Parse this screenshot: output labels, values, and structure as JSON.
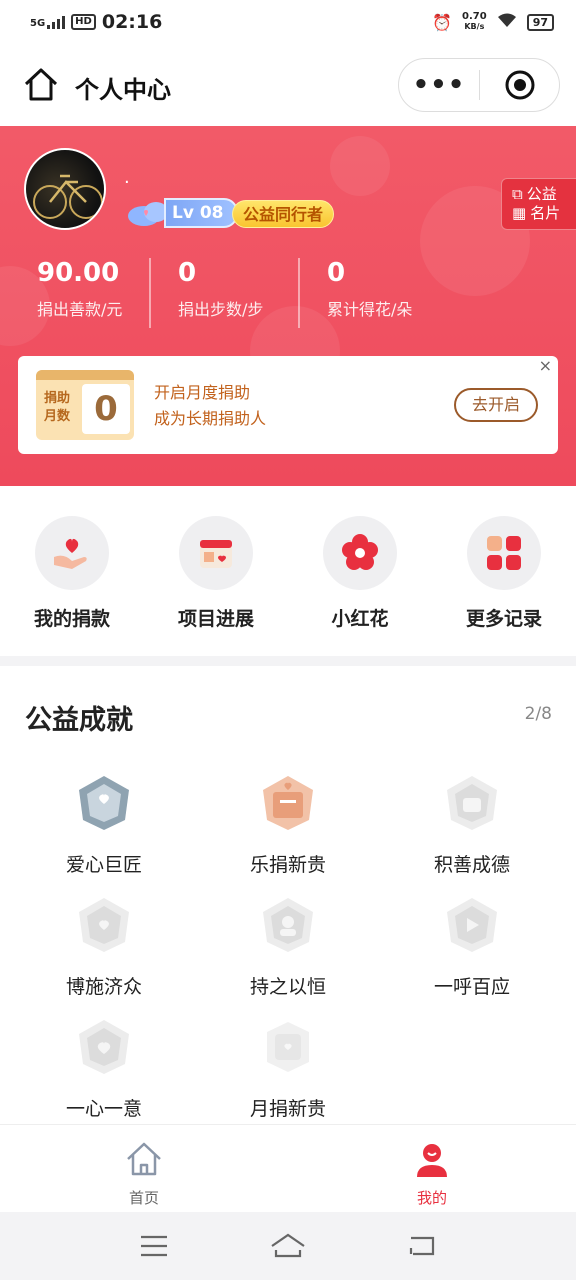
{
  "status_bar": {
    "time": "02:16",
    "network": "5G",
    "hd": "HD",
    "speed": "0.70",
    "speed_unit": "KB/s",
    "battery": "97"
  },
  "nav": {
    "title": "个人中心",
    "more": "•••"
  },
  "profile": {
    "username": "·",
    "level": "Lv 08",
    "title_badge": "公益同行者",
    "card_button": [
      "公益",
      "名片"
    ],
    "stats": [
      {
        "value": "90.00",
        "label": "捐出善款/元"
      },
      {
        "value": "0",
        "label": "捐出步数/步"
      },
      {
        "value": "0",
        "label": "累计得花/朵"
      }
    ]
  },
  "promo": {
    "calendar_label": [
      "捐助",
      "月数"
    ],
    "calendar_value": "0",
    "line1": "开启月度捐助",
    "line2": "成为长期捐助人",
    "button": "去开启",
    "close": "×"
  },
  "quick_actions": [
    {
      "label": "我的捐款",
      "icon": "donation-hand-heart-icon"
    },
    {
      "label": "项目进展",
      "icon": "calendar-heart-icon"
    },
    {
      "label": "小红花",
      "icon": "red-flower-icon"
    },
    {
      "label": "更多记录",
      "icon": "grid-apps-icon"
    }
  ],
  "achievements": {
    "title": "公益成就",
    "count": "2/8",
    "items": [
      {
        "name": "爱心巨匠",
        "state": "earned-silver"
      },
      {
        "name": "乐捐新贵",
        "state": "earned-bronze"
      },
      {
        "name": "积善成德",
        "state": "locked"
      },
      {
        "name": "博施济众",
        "state": "locked"
      },
      {
        "name": "持之以恒",
        "state": "locked"
      },
      {
        "name": "一呼百应",
        "state": "locked"
      },
      {
        "name": "一心一意",
        "state": "locked"
      },
      {
        "name": "月捐新贵",
        "state": "locked"
      }
    ]
  },
  "tabbar": [
    {
      "label": "首页",
      "active": false
    },
    {
      "label": "我的",
      "active": true
    }
  ],
  "colors": {
    "accent": "#e8303f",
    "hero": "#f25a68",
    "gold": "#f9c530"
  }
}
